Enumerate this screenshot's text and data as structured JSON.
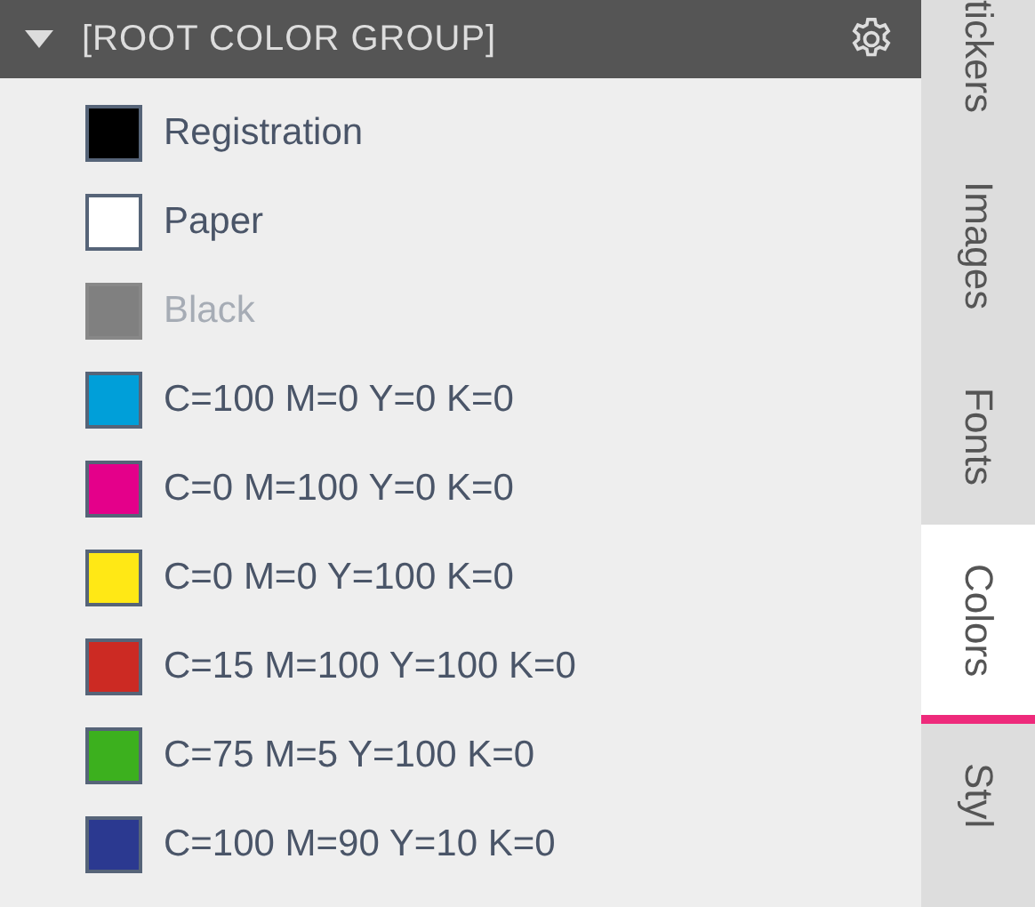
{
  "group": {
    "title": "[ROOT COLOR GROUP]",
    "expanded": true
  },
  "swatches": [
    {
      "name": "Registration",
      "color": "#000000",
      "disabled": false
    },
    {
      "name": "Paper",
      "color": "#ffffff",
      "disabled": false
    },
    {
      "name": "Black",
      "color": "#808080",
      "disabled": true
    },
    {
      "name": "C=100 M=0 Y=0 K=0",
      "color": "#009fd9",
      "disabled": false
    },
    {
      "name": "C=0 M=100 Y=0 K=0",
      "color": "#e4008a",
      "disabled": false
    },
    {
      "name": "C=0 M=0 Y=100 K=0",
      "color": "#ffe815",
      "disabled": false
    },
    {
      "name": "C=15 M=100 Y=100 K=0",
      "color": "#cc2a23",
      "disabled": false
    },
    {
      "name": "C=75 M=5 Y=100 K=0",
      "color": "#3cb01e",
      "disabled": false
    },
    {
      "name": "C=100 M=90 Y=10 K=0",
      "color": "#2b3990",
      "disabled": false
    }
  ],
  "tabs": [
    {
      "label": "tickers",
      "selected": false
    },
    {
      "label": "Images",
      "selected": false
    },
    {
      "label": "Fonts",
      "selected": false
    },
    {
      "label": "Colors",
      "selected": true
    },
    {
      "label": "Styl",
      "selected": false
    }
  ]
}
